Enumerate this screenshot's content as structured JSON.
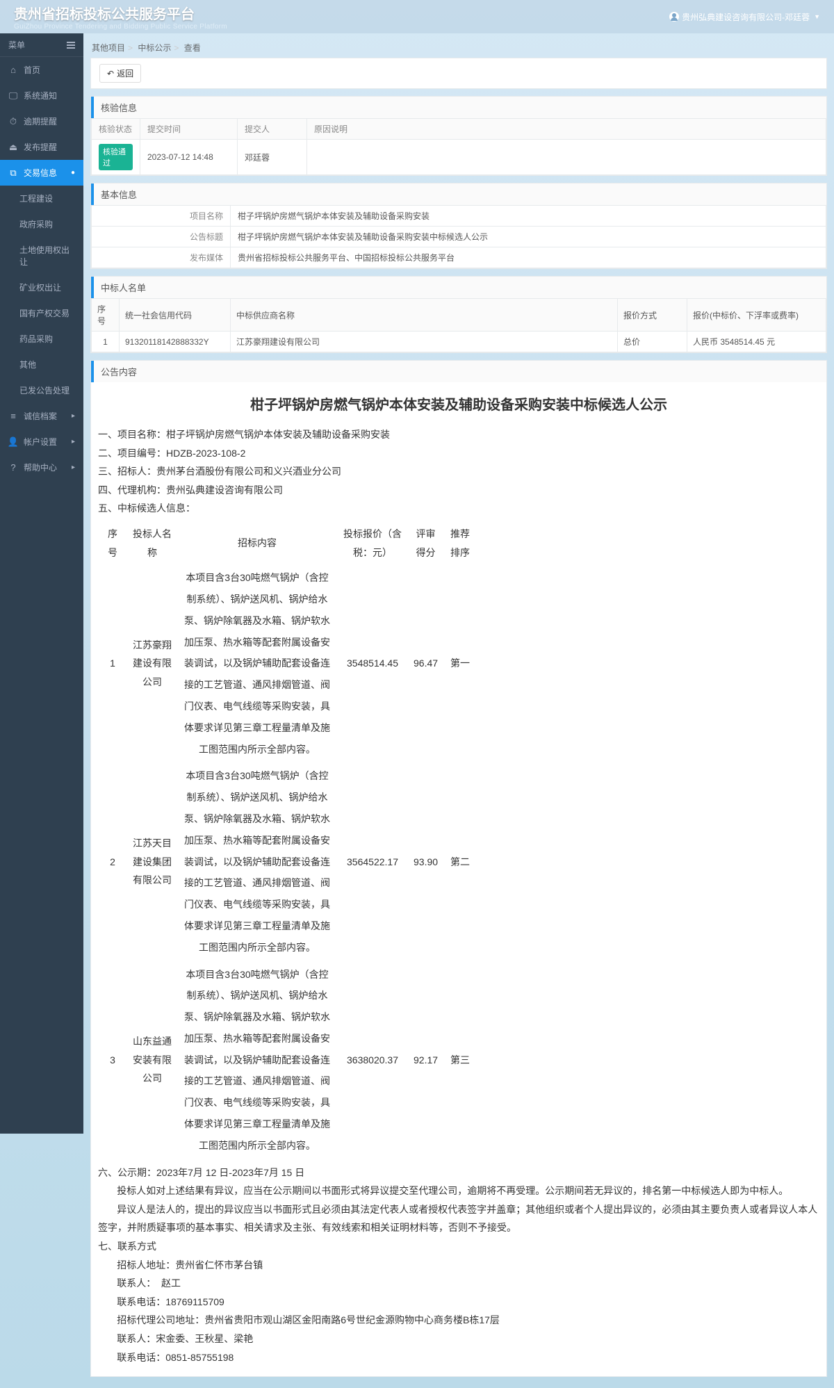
{
  "header": {
    "title": "贵州省招标投标公共服务平台",
    "subtitle": "GuiZhou Province Tendering and Bidding Public Service Platform",
    "user": "贵州弘典建设咨询有限公司-邓廷蓉"
  },
  "sidebar": {
    "menu_label": "菜单",
    "items": [
      {
        "icon": "⌂",
        "label": "首页"
      },
      {
        "icon": "🖵",
        "label": "系统通知"
      },
      {
        "icon": "⏱",
        "label": "逾期提醒"
      },
      {
        "icon": "⏏",
        "label": "发布提醒"
      },
      {
        "icon": "⧉",
        "label": "交易信息",
        "active": true
      },
      {
        "icon": "≡",
        "label": "诚信档案"
      },
      {
        "icon": "👤",
        "label": "帐户设置"
      },
      {
        "icon": "?",
        "label": "帮助中心"
      }
    ],
    "sub": [
      "工程建设",
      "政府采购",
      "土地使用权出让",
      "矿业权出让",
      "国有产权交易",
      "药品采购",
      "其他",
      "已发公告处理"
    ]
  },
  "breadcrumb": {
    "a": "其他项目",
    "b": "中标公示",
    "c": "查看"
  },
  "back_label": "返回",
  "sections": {
    "verify": "核验信息",
    "basic": "基本信息",
    "bidders": "中标人名单",
    "content": "公告内容"
  },
  "verify": {
    "cols": [
      "核验状态",
      "提交时间",
      "提交人",
      "原因说明"
    ],
    "status": "核验通过",
    "time": "2023-07-12 14:48",
    "submitter": "邓廷蓉",
    "reason": ""
  },
  "basic": {
    "labels": {
      "name": "项目名称",
      "title": "公告标题",
      "media": "发布媒体"
    },
    "name": "柑子坪锅炉房燃气锅炉本体安装及辅助设备采购安装",
    "title": "柑子坪锅炉房燃气锅炉本体安装及辅助设备采购安装中标候选人公示",
    "media": "贵州省招标投标公共服务平台、中国招标投标公共服务平台"
  },
  "bidders": {
    "cols": [
      "序号",
      "统一社会信用代码",
      "中标供应商名称",
      "报价方式",
      "报价(中标价、下浮率或费率)"
    ],
    "rows": [
      {
        "seq": "1",
        "code": "91320118142888332Y",
        "name": "江苏豪翔建设有限公司",
        "method": "总价",
        "price": "人民币 3548514.45 元"
      }
    ]
  },
  "doc": {
    "title": "柑子坪锅炉房燃气锅炉本体安装及辅助设备采购安装中标候选人公示",
    "l1": "一、项目名称：柑子坪锅炉房燃气锅炉本体安装及辅助设备采购安装",
    "l2": "二、项目编号：HDZB-2023-108-2",
    "l3": "三、招标人：贵州茅台酒股份有限公司和义兴酒业分公司",
    "l4": "四、代理机构：贵州弘典建设咨询有限公司",
    "l5": "五、中标候选人信息：",
    "table_cols": [
      "序号",
      "投标人名称",
      "招标内容",
      "投标报价（含税：元）",
      "评审得分",
      "推荐排序"
    ],
    "rows": [
      {
        "seq": "1",
        "name": "江苏豪翔建设有限公司",
        "content": "本项目含3台30吨燃气锅炉（含控制系统）、锅炉送风机、锅炉给水泵、锅炉除氧器及水箱、锅炉软水加压泵、热水箱等配套附属设备安装调试，以及锅炉辅助配套设备连接的工艺管道、通风排烟管道、阀门仪表、电气线缆等采购安装，具体要求详见第三章工程量清单及施工图范围内所示全部内容。",
        "price": "3548514.45",
        "score": "96.47",
        "rank": "第一"
      },
      {
        "seq": "2",
        "name": "江苏天目建设集团有限公司",
        "content": "本项目含3台30吨燃气锅炉（含控制系统）、锅炉送风机、锅炉给水泵、锅炉除氧器及水箱、锅炉软水加压泵、热水箱等配套附属设备安装调试，以及锅炉辅助配套设备连接的工艺管道、通风排烟管道、阀门仪表、电气线缆等采购安装，具体要求详见第三章工程量清单及施工图范围内所示全部内容。",
        "price": "3564522.17",
        "score": "93.90",
        "rank": "第二"
      },
      {
        "seq": "3",
        "name": "山东益通安装有限公司",
        "content": "本项目含3台30吨燃气锅炉（含控制系统）、锅炉送风机、锅炉给水泵、锅炉除氧器及水箱、锅炉软水加压泵、热水箱等配套附属设备安装调试，以及锅炉辅助配套设备连接的工艺管道、通风排烟管道、阀门仪表、电气线缆等采购安装，具体要求详见第三章工程量清单及施工图范围内所示全部内容。",
        "price": "3638020.37",
        "score": "92.17",
        "rank": "第三"
      }
    ],
    "l6": "六、公示期：2023年7月  12 日-2023年7月 15   日",
    "p1": "       投标人如对上述结果有异议，应当在公示期间以书面形式将异议提交至代理公司，逾期将不再受理。公示期间若无异议的，排名第一中标候选人即为中标人。",
    "p2": "       异议人是法人的，提出的异议应当以书面形式且必须由其法定代表人或者授权代表签字并盖章；其他组织或者个人提出异议的，必须由其主要负责人或者异议人本人签字，并附质疑事项的基本事实、相关请求及主张、有效线索和相关证明材料等，否则不予接受。",
    "l7": "七、联系方式",
    "c1": "       招标人地址：贵州省仁怀市茅台镇",
    "c2": "       联系人：  赵工",
    "c3": "       联系电话：18769115709",
    "c4": "       招标代理公司地址：贵州省贵阳市观山湖区金阳南路6号世纪金源购物中心商务楼B栋17层",
    "c5": "       联系人：宋金委、王秋星、梁艳",
    "c6": "       联系电话：0851-85755198"
  }
}
